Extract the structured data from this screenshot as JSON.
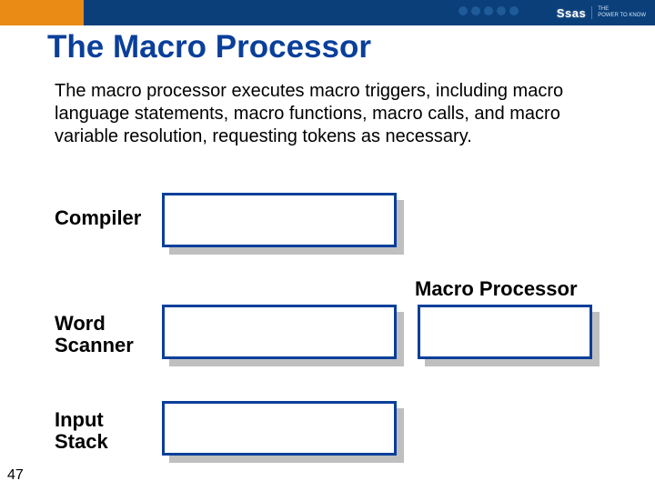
{
  "header": {
    "logo_text": "Ssas",
    "tagline1": "THE",
    "tagline2": "POWER TO KNOW"
  },
  "title": "The Macro Processor",
  "body": "The macro processor executes macro triggers, including macro language statements, macro functions, macro calls, and macro variable resolution, requesting tokens as necessary.",
  "labels": {
    "compiler": "Compiler",
    "macro_processor": "Macro Processor",
    "word_scanner_line1": "Word",
    "word_scanner_line2": "Scanner",
    "input_stack_line1": "Input",
    "input_stack_line2": "Stack"
  },
  "page_number": "47",
  "colors": {
    "header_blue": "#0a3f7a",
    "accent_orange": "#e98b14",
    "title_blue": "#0a3f9a",
    "box_border": "#0a3f9a",
    "shadow_gray": "#bfbfbf"
  }
}
